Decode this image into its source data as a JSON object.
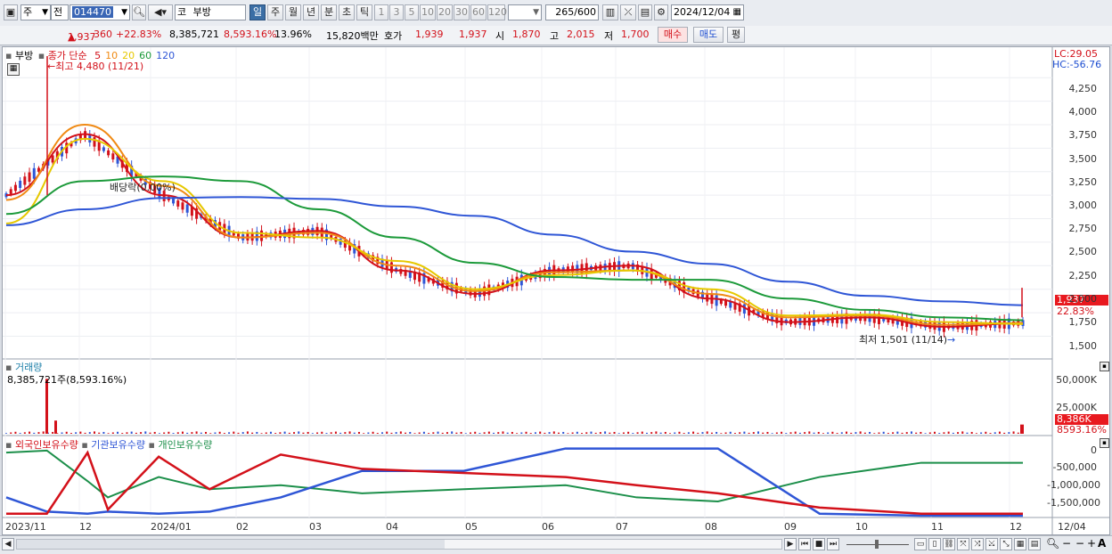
{
  "toolbar": {
    "market_label": "주",
    "prev_label": "전",
    "code": "014470",
    "stock_prefix": "코",
    "stock_name": "부방",
    "period_buttons": [
      "일",
      "주",
      "월",
      "년",
      "분",
      "초",
      "틱"
    ],
    "active_period": "일",
    "interval_buttons": [
      "1",
      "3",
      "5",
      "10",
      "20",
      "30",
      "60",
      "120"
    ],
    "count_value": "265",
    "count_max": "/600",
    "date_value": "2024/12/04"
  },
  "infobar": {
    "price": "1,937",
    "change_arrow": "▲",
    "change": "360",
    "change_pct": "+22.83%",
    "volume": "8,385,721",
    "turnover_pct": "8,593.16%",
    "ratio": "13.96%",
    "amount": "15,820백만",
    "quote_label": "호가",
    "quote1": "1,939",
    "quote2": "1,937",
    "open_label": "시",
    "open": "1,870",
    "high_label": "고",
    "high": "2,015",
    "low_label": "저",
    "low": "1,700",
    "buy_label": "매수",
    "sell_label": "매도",
    "eval_label": "평"
  },
  "price_panel": {
    "legend_name": "부방",
    "legend_text": "종가 단순",
    "ma_labels": [
      "5",
      "10",
      "20",
      "60",
      "120"
    ],
    "ma_colors": [
      "#d3111a",
      "#f08a14",
      "#e6c800",
      "#1c9a3a",
      "#2f56d6"
    ],
    "lc_label": "LC:29.05",
    "hc_label": "HC:-56.76",
    "high_annotation": "최고 4,480 (11/21)",
    "low_annotation": "최저 1,501 (11/14)",
    "dividend_annotation": "배당락(0.00%)",
    "current_tag": "1,937",
    "current_pct": "22.83%",
    "y_ticks": [
      "4,250",
      "4,000",
      "3,750",
      "3,500",
      "3,250",
      "3,000",
      "2,750",
      "2,500",
      "2,250",
      "2,000",
      "1,750",
      "1,500"
    ]
  },
  "volume_panel": {
    "title": "거래량",
    "value_text": "8,385,721주(8,593.16%)",
    "y_ticks": [
      "50,000K",
      "25,000K"
    ],
    "current_tag": "8,386K",
    "current_pct": "8593.16%"
  },
  "holdings_panel": {
    "legend": [
      "외국인보유수량",
      "기관보유수량",
      "개인보유수량"
    ],
    "legend_colors": [
      "#d3111a",
      "#2f56d6",
      "#1c8f4a"
    ],
    "y_ticks": [
      "0",
      "-500,000",
      "-1,000,000",
      "-1,500,000"
    ]
  },
  "x_axis": {
    "labels": [
      "2023/11",
      "12",
      "2024/01",
      "02",
      "03",
      "04",
      "05",
      "06",
      "07",
      "08",
      "09",
      "10",
      "11",
      "12"
    ],
    "right_label": "12/04"
  },
  "chart_data": {
    "type": "line",
    "title": "부방 (014470) 일봉",
    "period": "2023/11 - 2024/12/04",
    "price_ylim": [
      1400,
      4480
    ],
    "ma_series": [
      {
        "name": "5",
        "months": [
          "2023/11",
          "12",
          "2024/01",
          "02",
          "03",
          "04",
          "05",
          "06",
          "07",
          "08",
          "09",
          "10",
          "11",
          "12"
        ],
        "values": [
          3000,
          3650,
          3000,
          2550,
          2620,
          2200,
          1950,
          2200,
          2250,
          1900,
          1650,
          1700,
          1600,
          1640
        ]
      },
      {
        "name": "10",
        "values": [
          2950,
          3750,
          3100,
          2550,
          2600,
          2250,
          1980,
          2180,
          2200,
          1950,
          1700,
          1720,
          1620,
          1640
        ]
      },
      {
        "name": "20",
        "values": [
          2700,
          3600,
          3150,
          2600,
          2550,
          2300,
          2000,
          2150,
          2200,
          2000,
          1720,
          1730,
          1650,
          1630
        ]
      },
      {
        "name": "60",
        "values": [
          2800,
          3150,
          3200,
          3150,
          2850,
          2550,
          2280,
          2130,
          2100,
          2100,
          1900,
          1780,
          1700,
          1670
        ]
      },
      {
        "name": "120",
        "values": [
          2680,
          2850,
          2970,
          2980,
          2960,
          2880,
          2780,
          2580,
          2400,
          2270,
          2080,
          1930,
          1870,
          1830
        ]
      }
    ],
    "price_points": {
      "high": {
        "date": "11/21",
        "value": 4480
      },
      "low": {
        "date": "11/14",
        "value": 1501
      },
      "last": 1937,
      "open": 1870,
      "day_high": 2015,
      "day_low": 1700
    },
    "volume": {
      "last": 8385721,
      "unit": "주",
      "spike_early": 50000000
    },
    "holdings": {
      "series": [
        {
          "name": "외국인보유수량"
        },
        {
          "name": "기관보유수량"
        },
        {
          "name": "개인보유수량"
        }
      ],
      "ylim": [
        -1650000,
        100000
      ]
    },
    "grid": true,
    "legend_position": "top-left"
  }
}
